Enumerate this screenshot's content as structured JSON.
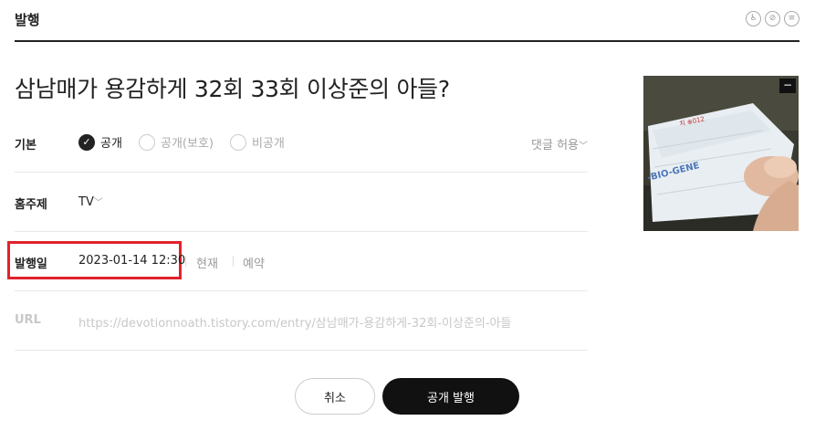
{
  "header": {
    "title": "발행",
    "icons": [
      "accessibility-icon",
      "no-copy-icon",
      "menu-icon"
    ]
  },
  "post": {
    "title": "삼남매가 용감하게 32회 33회 이상준의 아들?"
  },
  "visibility": {
    "label": "기본",
    "options": [
      {
        "label": "공개",
        "checked": true
      },
      {
        "label": "공개(보호)",
        "checked": false
      },
      {
        "label": "비공개",
        "checked": false
      }
    ],
    "comment_toggle": "댓글 허용"
  },
  "category": {
    "label": "홈주제",
    "value": "TV"
  },
  "publish_date": {
    "label": "발행일",
    "value": "2023-01-14 12:30",
    "now_label": "현재",
    "schedule_label": "예약"
  },
  "url": {
    "label": "URL",
    "value": "https://devotionnoath.tistory.com/entry/삼남매가-용감하게-32회-이상준의-아들"
  },
  "thumbnail": {
    "text_fragments": [
      "-BIO-GENE"
    ]
  },
  "buttons": {
    "cancel": "취소",
    "publish": "공개 발행"
  }
}
